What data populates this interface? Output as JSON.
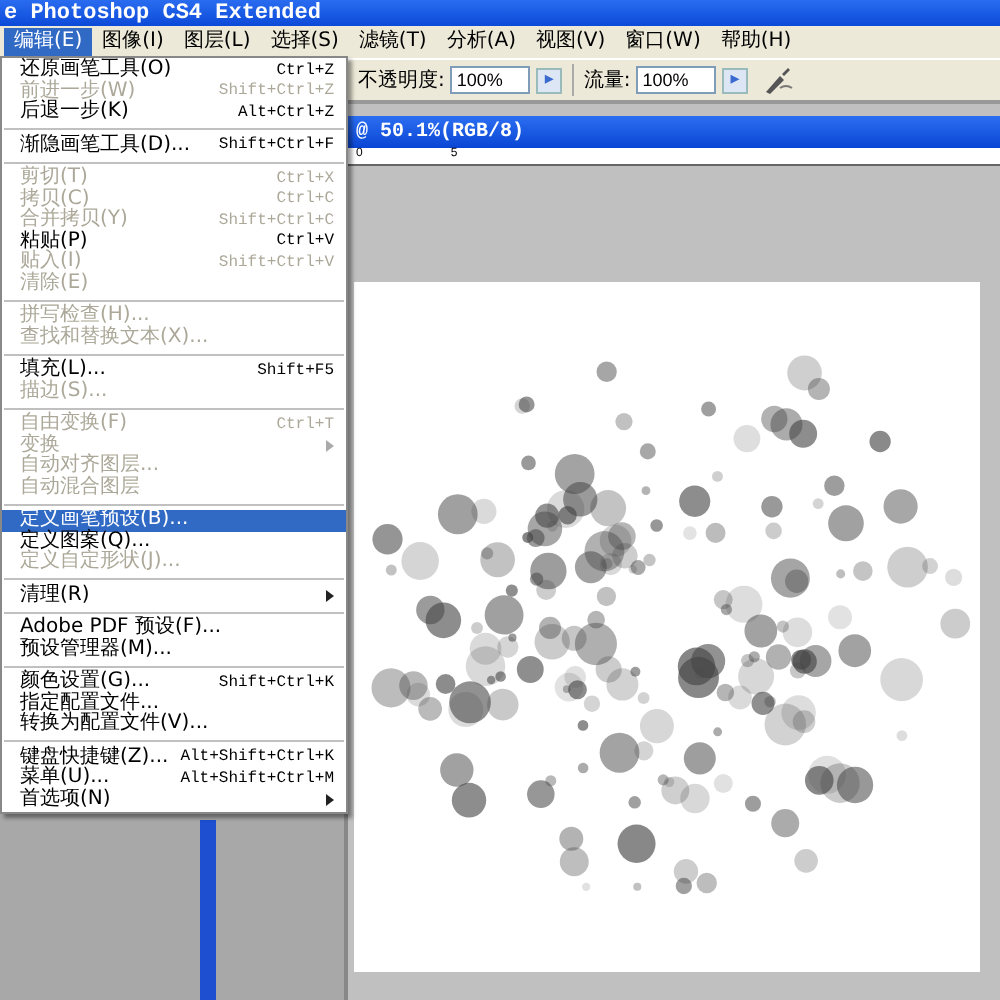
{
  "window": {
    "title": "e Photoshop CS4 Extended"
  },
  "menubar": [
    {
      "label": "编辑(E)",
      "selected": true
    },
    {
      "label": "图像(I)",
      "selected": false
    },
    {
      "label": "图层(L)",
      "selected": false
    },
    {
      "label": "选择(S)",
      "selected": false
    },
    {
      "label": "滤镜(T)",
      "selected": false
    },
    {
      "label": "分析(A)",
      "selected": false
    },
    {
      "label": "视图(V)",
      "selected": false
    },
    {
      "label": "窗口(W)",
      "selected": false
    },
    {
      "label": "帮助(H)",
      "selected": false
    }
  ],
  "options_bar": {
    "opacity_label": "不透明度:",
    "opacity_value": "100%",
    "flow_label": "流量:",
    "flow_value": "100%",
    "arrow": "▸"
  },
  "document": {
    "title": "@ 50.1%(RGB/8)",
    "ruler_labels": [
      "0",
      "5"
    ]
  },
  "edit_menu": [
    {
      "kind": "item",
      "label": "还原画笔工具(O)",
      "shortcut": "Ctrl+Z",
      "disabled": false,
      "selected": false
    },
    {
      "kind": "item",
      "label": "前进一步(W)",
      "shortcut": "Shift+Ctrl+Z",
      "disabled": true,
      "selected": false
    },
    {
      "kind": "item",
      "label": "后退一步(K)",
      "shortcut": "Alt+Ctrl+Z",
      "disabled": false,
      "selected": false
    },
    {
      "kind": "separator"
    },
    {
      "kind": "item",
      "label": "渐隐画笔工具(D)...",
      "shortcut": "Shift+Ctrl+F",
      "disabled": false,
      "selected": false
    },
    {
      "kind": "separator"
    },
    {
      "kind": "item",
      "label": "剪切(T)",
      "shortcut": "Ctrl+X",
      "disabled": true,
      "selected": false
    },
    {
      "kind": "item",
      "label": "拷贝(C)",
      "shortcut": "Ctrl+C",
      "disabled": true,
      "selected": false
    },
    {
      "kind": "item",
      "label": "合并拷贝(Y)",
      "shortcut": "Shift+Ctrl+C",
      "disabled": true,
      "selected": false
    },
    {
      "kind": "item",
      "label": "粘贴(P)",
      "shortcut": "Ctrl+V",
      "disabled": false,
      "selected": false
    },
    {
      "kind": "item",
      "label": "贴入(I)",
      "shortcut": "Shift+Ctrl+V",
      "disabled": true,
      "selected": false
    },
    {
      "kind": "item",
      "label": "清除(E)",
      "disabled": true,
      "selected": false
    },
    {
      "kind": "separator"
    },
    {
      "kind": "item",
      "label": "拼写检查(H)...",
      "disabled": true,
      "selected": false
    },
    {
      "kind": "item",
      "label": "查找和替换文本(X)...",
      "disabled": true,
      "selected": false
    },
    {
      "kind": "separator"
    },
    {
      "kind": "item",
      "label": "填充(L)...",
      "shortcut": "Shift+F5",
      "disabled": false,
      "selected": false
    },
    {
      "kind": "item",
      "label": "描边(S)...",
      "disabled": true,
      "selected": false
    },
    {
      "kind": "separator"
    },
    {
      "kind": "item",
      "label": "自由变换(F)",
      "shortcut": "Ctrl+T",
      "disabled": true,
      "selected": false
    },
    {
      "kind": "submenu",
      "label": "变换",
      "disabled": true,
      "selected": false
    },
    {
      "kind": "item",
      "label": "自动对齐图层...",
      "disabled": true,
      "selected": false
    },
    {
      "kind": "item",
      "label": "自动混合图层",
      "disabled": true,
      "selected": false
    },
    {
      "kind": "separator"
    },
    {
      "kind": "item",
      "label": "定义画笔预设(B)...",
      "disabled": false,
      "selected": true
    },
    {
      "kind": "item",
      "label": "定义图案(Q)...",
      "disabled": false,
      "selected": false
    },
    {
      "kind": "item",
      "label": "定义自定形状(J)...",
      "disabled": true,
      "selected": false
    },
    {
      "kind": "separator"
    },
    {
      "kind": "submenu",
      "label": "清理(R)",
      "disabled": false,
      "selected": false
    },
    {
      "kind": "separator"
    },
    {
      "kind": "item",
      "label": "Adobe PDF 预设(F)...",
      "disabled": false,
      "selected": false
    },
    {
      "kind": "item",
      "label": "预设管理器(M)...",
      "disabled": false,
      "selected": false
    },
    {
      "kind": "separator"
    },
    {
      "kind": "item",
      "label": "颜色设置(G)...",
      "shortcut": "Shift+Ctrl+K",
      "disabled": false,
      "selected": false
    },
    {
      "kind": "item",
      "label": "指定配置文件...",
      "disabled": false,
      "selected": false
    },
    {
      "kind": "item",
      "label": "转换为配置文件(V)...",
      "disabled": false,
      "selected": false
    },
    {
      "kind": "separator"
    },
    {
      "kind": "item",
      "label": "键盘快捷键(Z)...",
      "shortcut": "Alt+Shift+Ctrl+K",
      "disabled": false,
      "selected": false
    },
    {
      "kind": "item",
      "label": "菜单(U)...",
      "shortcut": "Alt+Shift+Ctrl+M",
      "disabled": false,
      "selected": false
    },
    {
      "kind": "submenu",
      "label": "首选项(N)",
      "disabled": false,
      "selected": false
    }
  ]
}
